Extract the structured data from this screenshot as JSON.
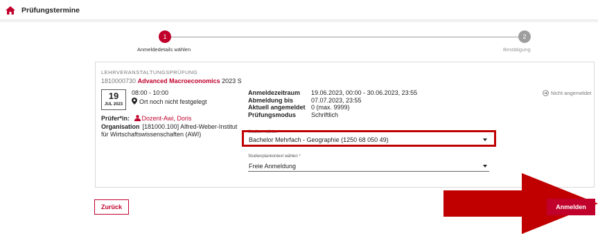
{
  "header": {
    "title": "Prüfungstermine",
    "icon": "home-icon"
  },
  "stepper": {
    "steps": [
      {
        "number": "1",
        "label": "Anmeldedetails wählen",
        "state": "active"
      },
      {
        "number": "2",
        "label": "Bestätigung",
        "state": "inactive"
      }
    ]
  },
  "course": {
    "type": "LEHRVERANSTALTUNGSPRÜFUNG",
    "id": "1810000730",
    "name": "Advanced Macroeconomics",
    "semester": "2023 S"
  },
  "exam": {
    "day": "19",
    "month_year": "JUL 2023",
    "time": "08:00 - 10:00",
    "location": "Ort noch nicht festgelegt",
    "examiner_label": "Prüfer*in:",
    "examiner": "Dozent-Awi, Doris",
    "org_label": "Organisation",
    "org_line1": "[181000.100] Alfred-Weber-Institut",
    "org_line2": "für Wirtschaftswissenschaften (AWI)"
  },
  "details": {
    "rows": [
      {
        "key": "Anmeldezeitraum",
        "value": "19.06.2023, 00:00 - 30.06.2023, 23:55"
      },
      {
        "key": "Abmeldung bis",
        "value": "07.07.2023, 23:55"
      },
      {
        "key": "Aktuell angemeldet",
        "value": "0 (max. 9999)"
      },
      {
        "key": "Prüfungsmodus",
        "value": "Schriftlich"
      }
    ]
  },
  "status": {
    "text": "Nicht angemeldet",
    "icon": "arrow-circle-icon"
  },
  "form": {
    "studium_label": "Studium wählen *",
    "studium_value": "Bachelor Mehrfach - Geographie (1250 68 050 49)",
    "kontext_label": "Studienplankontext wählen *",
    "kontext_value": "Freie Anmeldung"
  },
  "buttons": {
    "back": "Zurück",
    "submit": "Anmelden"
  },
  "colors": {
    "accent": "#c0002b",
    "annotation": "#c00000",
    "inactive": "#9e9e9e"
  }
}
